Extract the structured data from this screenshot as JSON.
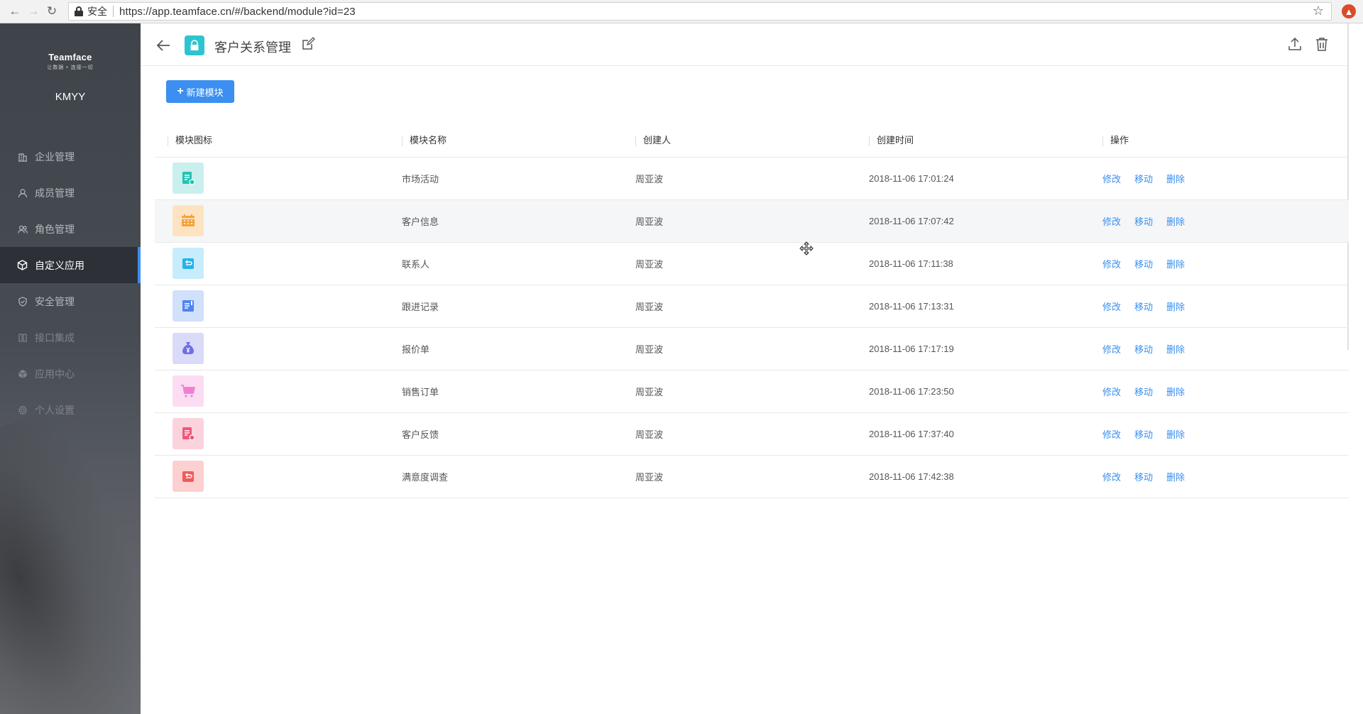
{
  "browser": {
    "secure_label": "安全",
    "url": "https://app.teamface.cn/#/backend/module?id=23"
  },
  "sidebar": {
    "brand": "Teamface",
    "slogan": "让数据 • 连接一切",
    "company": "KMYY",
    "items": [
      {
        "label": "企业管理",
        "icon": "building-icon"
      },
      {
        "label": "成员管理",
        "icon": "user-icon"
      },
      {
        "label": "角色管理",
        "icon": "users-icon"
      },
      {
        "label": "自定义应用",
        "icon": "cube-icon"
      },
      {
        "label": "安全管理",
        "icon": "shield-icon"
      },
      {
        "label": "接口集成",
        "icon": "plug-icon"
      },
      {
        "label": "应用中心",
        "icon": "box-icon"
      },
      {
        "label": "个人设置",
        "icon": "gear-icon"
      }
    ]
  },
  "header": {
    "title": "客户关系管理"
  },
  "toolbar": {
    "new_module_label": "新建模块"
  },
  "table": {
    "columns": [
      "模块图标",
      "模块名称",
      "创建人",
      "创建时间",
      "操作"
    ],
    "actions": {
      "edit": "修改",
      "move": "移动",
      "delete": "删除"
    },
    "rows": [
      {
        "name": "市场活动",
        "creator": "周亚波",
        "created": "2018-11-06 17:01:24",
        "icon": "document-icon",
        "color": "#22c3b4",
        "bg": "#c9f0ec"
      },
      {
        "name": "客户信息",
        "creator": "周亚波",
        "created": "2018-11-06 17:07:42",
        "icon": "calendar-icon",
        "color": "#f5a33b",
        "bg": "#fde3c2"
      },
      {
        "name": "联系人",
        "creator": "周亚波",
        "created": "2018-11-06 17:11:38",
        "icon": "contact-icon",
        "color": "#26b2ea",
        "bg": "#c7ecfb"
      },
      {
        "name": "跟进记录",
        "creator": "周亚波",
        "created": "2018-11-06 17:13:31",
        "icon": "note-icon",
        "color": "#4e86ee",
        "bg": "#d1e0fb"
      },
      {
        "name": "报价单",
        "creator": "周亚波",
        "created": "2018-11-06 17:17:19",
        "icon": "money-bag-icon",
        "color": "#6f6fe4",
        "bg": "#dadbf8"
      },
      {
        "name": "销售订单",
        "creator": "周亚波",
        "created": "2018-11-06 17:23:50",
        "icon": "cart-icon",
        "color": "#ef7fd3",
        "bg": "#fbdcf3"
      },
      {
        "name": "客户反馈",
        "creator": "周亚波",
        "created": "2018-11-06 17:37:40",
        "icon": "feedback-icon",
        "color": "#f0577b",
        "bg": "#fcd3dc"
      },
      {
        "name": "满意度调查",
        "creator": "周亚波",
        "created": "2018-11-06 17:42:38",
        "icon": "survey-icon",
        "color": "#ef5b5b",
        "bg": "#fcd0d0"
      }
    ]
  }
}
